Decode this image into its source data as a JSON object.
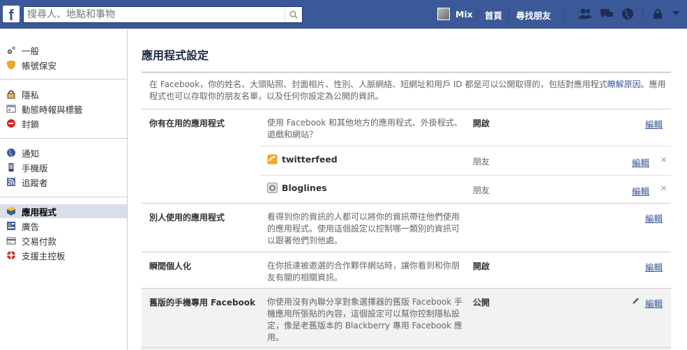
{
  "topbar": {
    "logo": "f",
    "search_placeholder": "搜尋人、地點和事物",
    "user_name": "Mix",
    "nav_home": "首頁",
    "nav_find_friends": "尋找朋友",
    "icons": [
      "friend-requests-icon",
      "messages-icon",
      "notifications-globe-icon",
      "privacy-shortcuts-icon",
      "account-menu-icon"
    ]
  },
  "sidebar": {
    "groups": [
      [
        {
          "label": "一般",
          "icon": "gears-icon"
        },
        {
          "label": "帳號保安",
          "icon": "shield-icon"
        }
      ],
      [
        {
          "label": "隱私",
          "icon": "lock-icon"
        },
        {
          "label": "動態時報與標籤",
          "icon": "timeline-icon"
        },
        {
          "label": "封鎖",
          "icon": "block-icon"
        }
      ],
      [
        {
          "label": "通知",
          "icon": "globe-icon"
        },
        {
          "label": "手機版",
          "icon": "mobile-icon"
        },
        {
          "label": "追蹤者",
          "icon": "rss-icon"
        }
      ],
      [
        {
          "label": "應用程式",
          "icon": "apps-icon",
          "active": true
        },
        {
          "label": "廣告",
          "icon": "ads-icon"
        },
        {
          "label": "交易付款",
          "icon": "payments-icon"
        },
        {
          "label": "支援主控板",
          "icon": "support-icon"
        }
      ]
    ]
  },
  "main": {
    "title": "應用程式設定",
    "intro_text": "在 Facebook，你的姓名、大頭貼照、封面相片、性別、人脈網絡、短網址和用戶 ID 都是可以公開取得的，包括對應用程式",
    "intro_link": "瞭解原因",
    "intro_text2": "。應用程式也可以存取你的朋友名單，以及任何你設定為公開的資訊。",
    "edit_label": "編輯",
    "rows": [
      {
        "label": "你有在用的應用程式",
        "desc": "使用 Facebook 和其他地方的應用程式、外掛程式、遊戲和網站？",
        "status": "開啟",
        "apps": [
          {
            "name": "twitterfeed",
            "audience": "朋友",
            "icon": "twitterfeed-icon"
          },
          {
            "name": "Bloglines",
            "audience": "朋友",
            "icon": "bloglines-icon"
          }
        ]
      },
      {
        "label": "別人使用的應用程式",
        "desc": "看得到你的資訊的人都可以將你的資訊帶往他們使用的應用程式。使用這個設定以控制哪一類別的資訊可以跟著他們到他處。",
        "status": ""
      },
      {
        "label": "瞬間個人化",
        "desc": "在你抵達被邀選的合作夥伴網站時，讓你看到和你朋友有關的相關資訊。",
        "status": "開啟"
      },
      {
        "label": "舊版的手機專用 Facebook",
        "desc": "你使用沒有內聯分享對象選擇器的舊版 Facebook 手機應用所張貼的內容，這個設定可以幫你控制隱私設定，像是老舊版本的 Blackberry 專用 Facebook 應用。",
        "status": "公開"
      }
    ]
  },
  "colors": {
    "brand_blue": "#3b5998",
    "active_bg": "#d8dfea"
  }
}
